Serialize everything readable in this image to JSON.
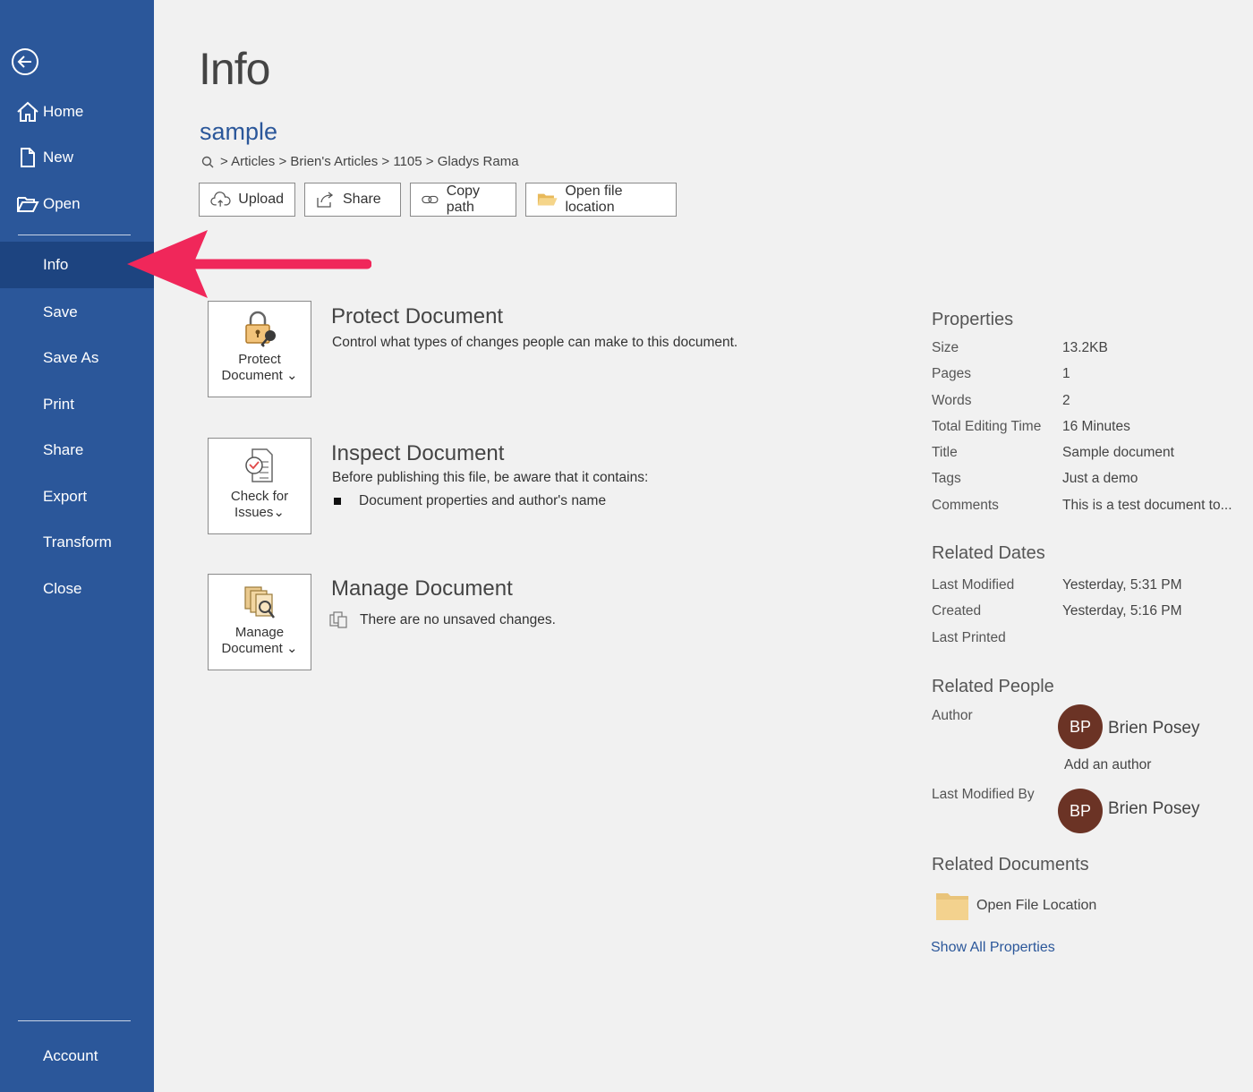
{
  "sidebar": {
    "items": [
      {
        "label": "Home",
        "icon": "home-icon"
      },
      {
        "label": "New",
        "icon": "new-document-icon"
      },
      {
        "label": "Open",
        "icon": "open-folder-icon"
      },
      {
        "label": "Info"
      },
      {
        "label": "Save"
      },
      {
        "label": "Save As"
      },
      {
        "label": "Print"
      },
      {
        "label": "Share"
      },
      {
        "label": "Export"
      },
      {
        "label": "Transform"
      },
      {
        "label": "Close"
      }
    ],
    "account": "Account",
    "active": "Info",
    "color": "#2b579a"
  },
  "main": {
    "title": "Info",
    "doc_name": "sample",
    "breadcrumb": "> Articles > Brien's Articles > 1105 > Gladys Rama",
    "buttons": {
      "upload": "Upload",
      "share": "Share",
      "copy_path": "Copy path",
      "open_location": "Open file location"
    },
    "protect": {
      "card_line1": "Protect",
      "card_line2": "Document",
      "title": "Protect Document",
      "desc": "Control what types of changes people can make to this document."
    },
    "inspect": {
      "card_line1": "Check for",
      "card_line2": "Issues",
      "title": "Inspect Document",
      "desc": "Before publishing this file, be aware that it contains:",
      "bullet": "Document properties and author's name"
    },
    "manage": {
      "card_line1": "Manage",
      "card_line2": "Document",
      "title": "Manage Document",
      "desc": "There are no unsaved changes."
    }
  },
  "properties": {
    "heading": "Properties",
    "rows": [
      {
        "label": "Size",
        "value": "13.2KB"
      },
      {
        "label": "Pages",
        "value": "1"
      },
      {
        "label": "Words",
        "value": "2"
      },
      {
        "label": "Total Editing Time",
        "value": "16 Minutes"
      },
      {
        "label": "Title",
        "value": "Sample document"
      },
      {
        "label": "Tags",
        "value": "Just a demo"
      },
      {
        "label": "Comments",
        "value": "This is a test document to..."
      }
    ],
    "dates_heading": "Related Dates",
    "dates": [
      {
        "label": "Last Modified",
        "value": "Yesterday, 5:31 PM"
      },
      {
        "label": "Created",
        "value": "Yesterday, 5:16 PM"
      },
      {
        "label": "Last Printed",
        "value": ""
      }
    ],
    "people_heading": "Related People",
    "author_label": "Author",
    "author_initials": "BP",
    "author_name": "Brien Posey",
    "add_author": "Add an author",
    "modified_by_label": "Last Modified By",
    "modified_initials": "BP",
    "modified_name": "Brien Posey",
    "docs_heading": "Related Documents",
    "open_file_location": "Open File Location",
    "show_all": "Show All Properties"
  },
  "colors": {
    "accent": "#2b579a",
    "avatar": "#6b3325",
    "annotation_arrow": "#f0275a"
  }
}
